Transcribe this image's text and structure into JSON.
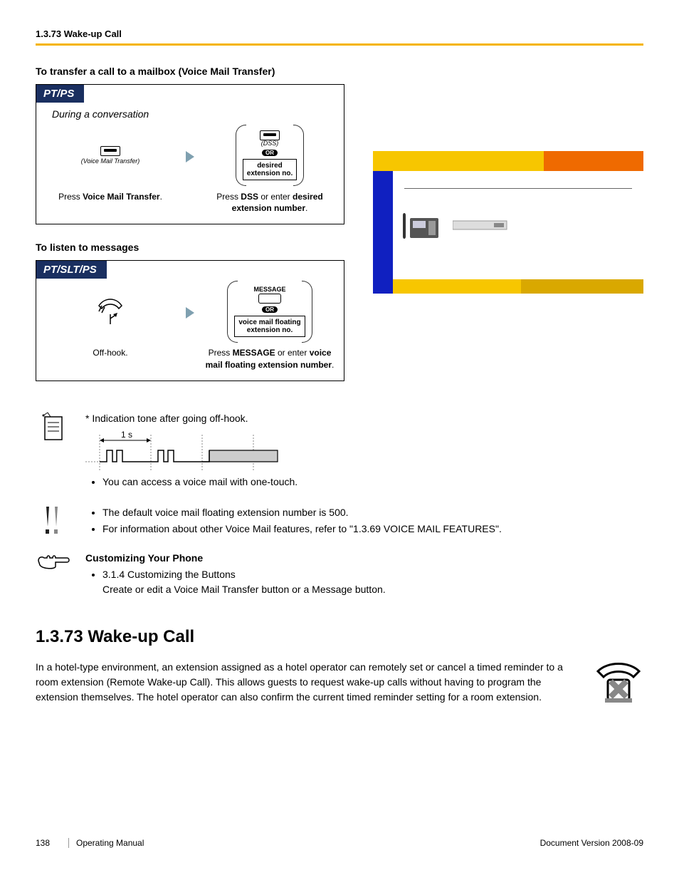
{
  "page_header": "1.3.73 Wake-up Call",
  "vm_transfer_heading": "To transfer a call to a mailbox (Voice Mail Transfer)",
  "listen_heading": "To listen to messages",
  "proc1": {
    "tab": "PT/PS",
    "context": "During a conversation",
    "step1": {
      "key_label": "(Voice Mail Transfer)",
      "callout_pre": "Press ",
      "callout_b": "Voice Mail Transfer",
      "callout_post": "."
    },
    "step2": {
      "dss_label": "(DSS)",
      "or": "OR",
      "input_label": "desired extension no.",
      "callout_pre": "Press ",
      "callout_b1": "DSS",
      "callout_mid": " or enter ",
      "callout_b2": "desired extension number",
      "callout_post": "."
    }
  },
  "proc2": {
    "tab": "PT/SLT/PS",
    "step1": {
      "callout": "Off-hook."
    },
    "step2": {
      "msg_label": "MESSAGE",
      "or": "OR",
      "input_label": "voice mail floating extension no.",
      "callout_pre": "Press ",
      "callout_b1": "MESSAGE",
      "callout_mid": " or enter ",
      "callout_b2": "voice mail floating extension number",
      "callout_post": "."
    }
  },
  "tone_note": "* Indication tone after going off-hook.",
  "tone_time": "1 s",
  "bullets1": [
    "You can access a voice mail with one-touch."
  ],
  "bullets2": [
    "The default voice mail floating extension number is 500.",
    "For information about other Voice Mail features, refer to \"1.3.69  VOICE MAIL FEATURES\"."
  ],
  "customize": {
    "heading": "Customizing Your Phone",
    "line1": "3.1.4  Customizing the Buttons",
    "line2": "Create or edit a Voice Mail Transfer button or a Message button."
  },
  "section_heading": "1.3.73  Wake-up Call",
  "section_body": "In a hotel-type environment, an extension assigned as a hotel operator can remotely set or cancel a timed reminder to a room extension (Remote Wake-up Call). This allows guests to request wake-up calls without having to program the extension themselves. The hotel operator can also confirm the current timed reminder setting for a room extension.",
  "footer_page": "138",
  "footer_manual": "Operating Manual",
  "footer_docver": "Document Version  2008-09"
}
